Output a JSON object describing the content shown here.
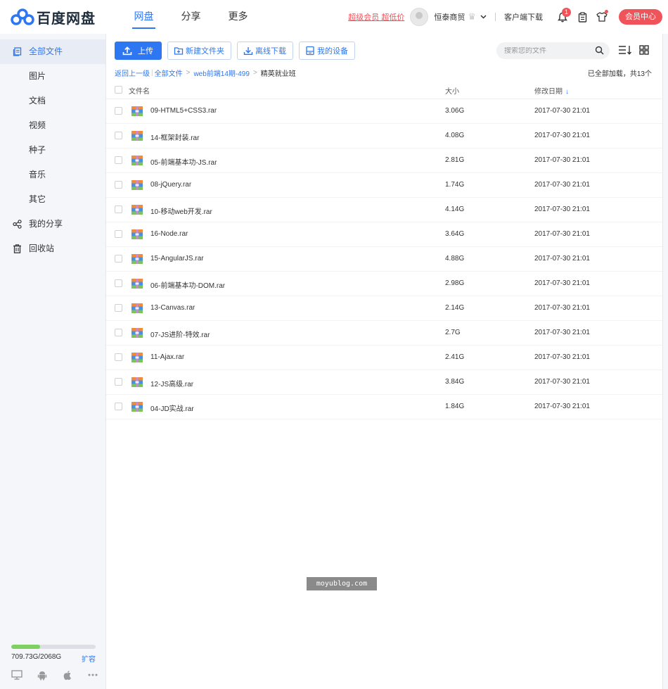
{
  "header": {
    "logo_text": "百度网盘",
    "nav": [
      {
        "label": "网盘",
        "active": true
      },
      {
        "label": "分享",
        "active": false
      },
      {
        "label": "更多",
        "active": false
      }
    ],
    "vip_link": "超级会员 超低价",
    "username": "恒泰商贸",
    "client_download": "客户端下载",
    "notification_count": "1",
    "member_center": "会员中心"
  },
  "sidebar": {
    "items": [
      {
        "label": "全部文件",
        "icon": "files-icon",
        "active": true
      },
      {
        "label": "图片",
        "icon": "",
        "active": false
      },
      {
        "label": "文档",
        "icon": "",
        "active": false
      },
      {
        "label": "视频",
        "icon": "",
        "active": false
      },
      {
        "label": "种子",
        "icon": "",
        "active": false
      },
      {
        "label": "音乐",
        "icon": "",
        "active": false
      },
      {
        "label": "其它",
        "icon": "",
        "active": false
      },
      {
        "label": "我的分享",
        "icon": "share-icon",
        "active": false
      },
      {
        "label": "回收站",
        "icon": "trash-icon",
        "active": false
      }
    ],
    "quota": {
      "text": "709.73G/2068G",
      "used_fraction": 0.343,
      "expand": "扩容"
    }
  },
  "toolbar": {
    "upload": "上传",
    "new_folder": "新建文件夹",
    "offline_download": "离线下载",
    "my_devices": "我的设备"
  },
  "search": {
    "placeholder": "搜索您的文件"
  },
  "breadcrumb": {
    "back": "返回上一级",
    "all_files": "全部文件",
    "parent": "web前端14期-499",
    "current": "精英就业班"
  },
  "load_status": "已全部加载，共13个",
  "table": {
    "headers": {
      "name": "文件名",
      "size": "大小",
      "date": "修改日期"
    },
    "rows": [
      {
        "name": "09-HTML5+CSS3.rar",
        "size": "3.06G",
        "date": "2017-07-30 21:01"
      },
      {
        "name": "14-框架封装.rar",
        "size": "4.08G",
        "date": "2017-07-30 21:01"
      },
      {
        "name": "05-前端基本功-JS.rar",
        "size": "2.81G",
        "date": "2017-07-30 21:01"
      },
      {
        "name": "08-jQuery.rar",
        "size": "1.74G",
        "date": "2017-07-30 21:01"
      },
      {
        "name": "10-移动web开发.rar",
        "size": "4.14G",
        "date": "2017-07-30 21:01"
      },
      {
        "name": "16-Node.rar",
        "size": "3.64G",
        "date": "2017-07-30 21:01"
      },
      {
        "name": "15-AngularJS.rar",
        "size": "4.88G",
        "date": "2017-07-30 21:01"
      },
      {
        "name": "06-前端基本功-DOM.rar",
        "size": "2.98G",
        "date": "2017-07-30 21:01"
      },
      {
        "name": "13-Canvas.rar",
        "size": "2.14G",
        "date": "2017-07-30 21:01"
      },
      {
        "name": "07-JS进阶-特效.rar",
        "size": "2.7G",
        "date": "2017-07-30 21:01"
      },
      {
        "name": "11-Ajax.rar",
        "size": "2.41G",
        "date": "2017-07-30 21:01"
      },
      {
        "name": "12-JS高级.rar",
        "size": "3.84G",
        "date": "2017-07-30 21:01"
      },
      {
        "name": "04-JD实战.rar",
        "size": "1.84G",
        "date": "2017-07-30 21:01"
      }
    ]
  },
  "watermark": "moyublog.com",
  "colors": {
    "accent": "#2e77f2",
    "vip_red": "#f0545b",
    "quota_green": "#7ed160"
  }
}
